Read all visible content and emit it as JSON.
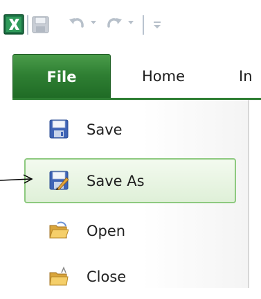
{
  "quick_access_toolbar": {
    "app_icon": "excel-logo-icon",
    "buttons": [
      {
        "name": "save-icon"
      },
      {
        "name": "undo-icon"
      },
      {
        "name": "redo-icon"
      },
      {
        "name": "customize-toolbar-icon"
      }
    ]
  },
  "ribbon": {
    "tabs": [
      {
        "label": "File",
        "active": true
      },
      {
        "label": "Home",
        "active": false
      },
      {
        "label": "In",
        "active": false
      }
    ],
    "active_color": "#2e7e33"
  },
  "backstage": {
    "items": [
      {
        "label": "Save",
        "icon": "save-icon",
        "selected": false
      },
      {
        "label": "Save As",
        "icon": "save-as-icon",
        "selected": true
      },
      {
        "label": "Open",
        "icon": "open-folder-icon",
        "selected": false
      },
      {
        "label": "Close",
        "icon": "close-folder-icon",
        "selected": false
      }
    ],
    "selected_color": "#8dc97f"
  },
  "annotation": {
    "icon": "pointer-arrow-icon"
  }
}
